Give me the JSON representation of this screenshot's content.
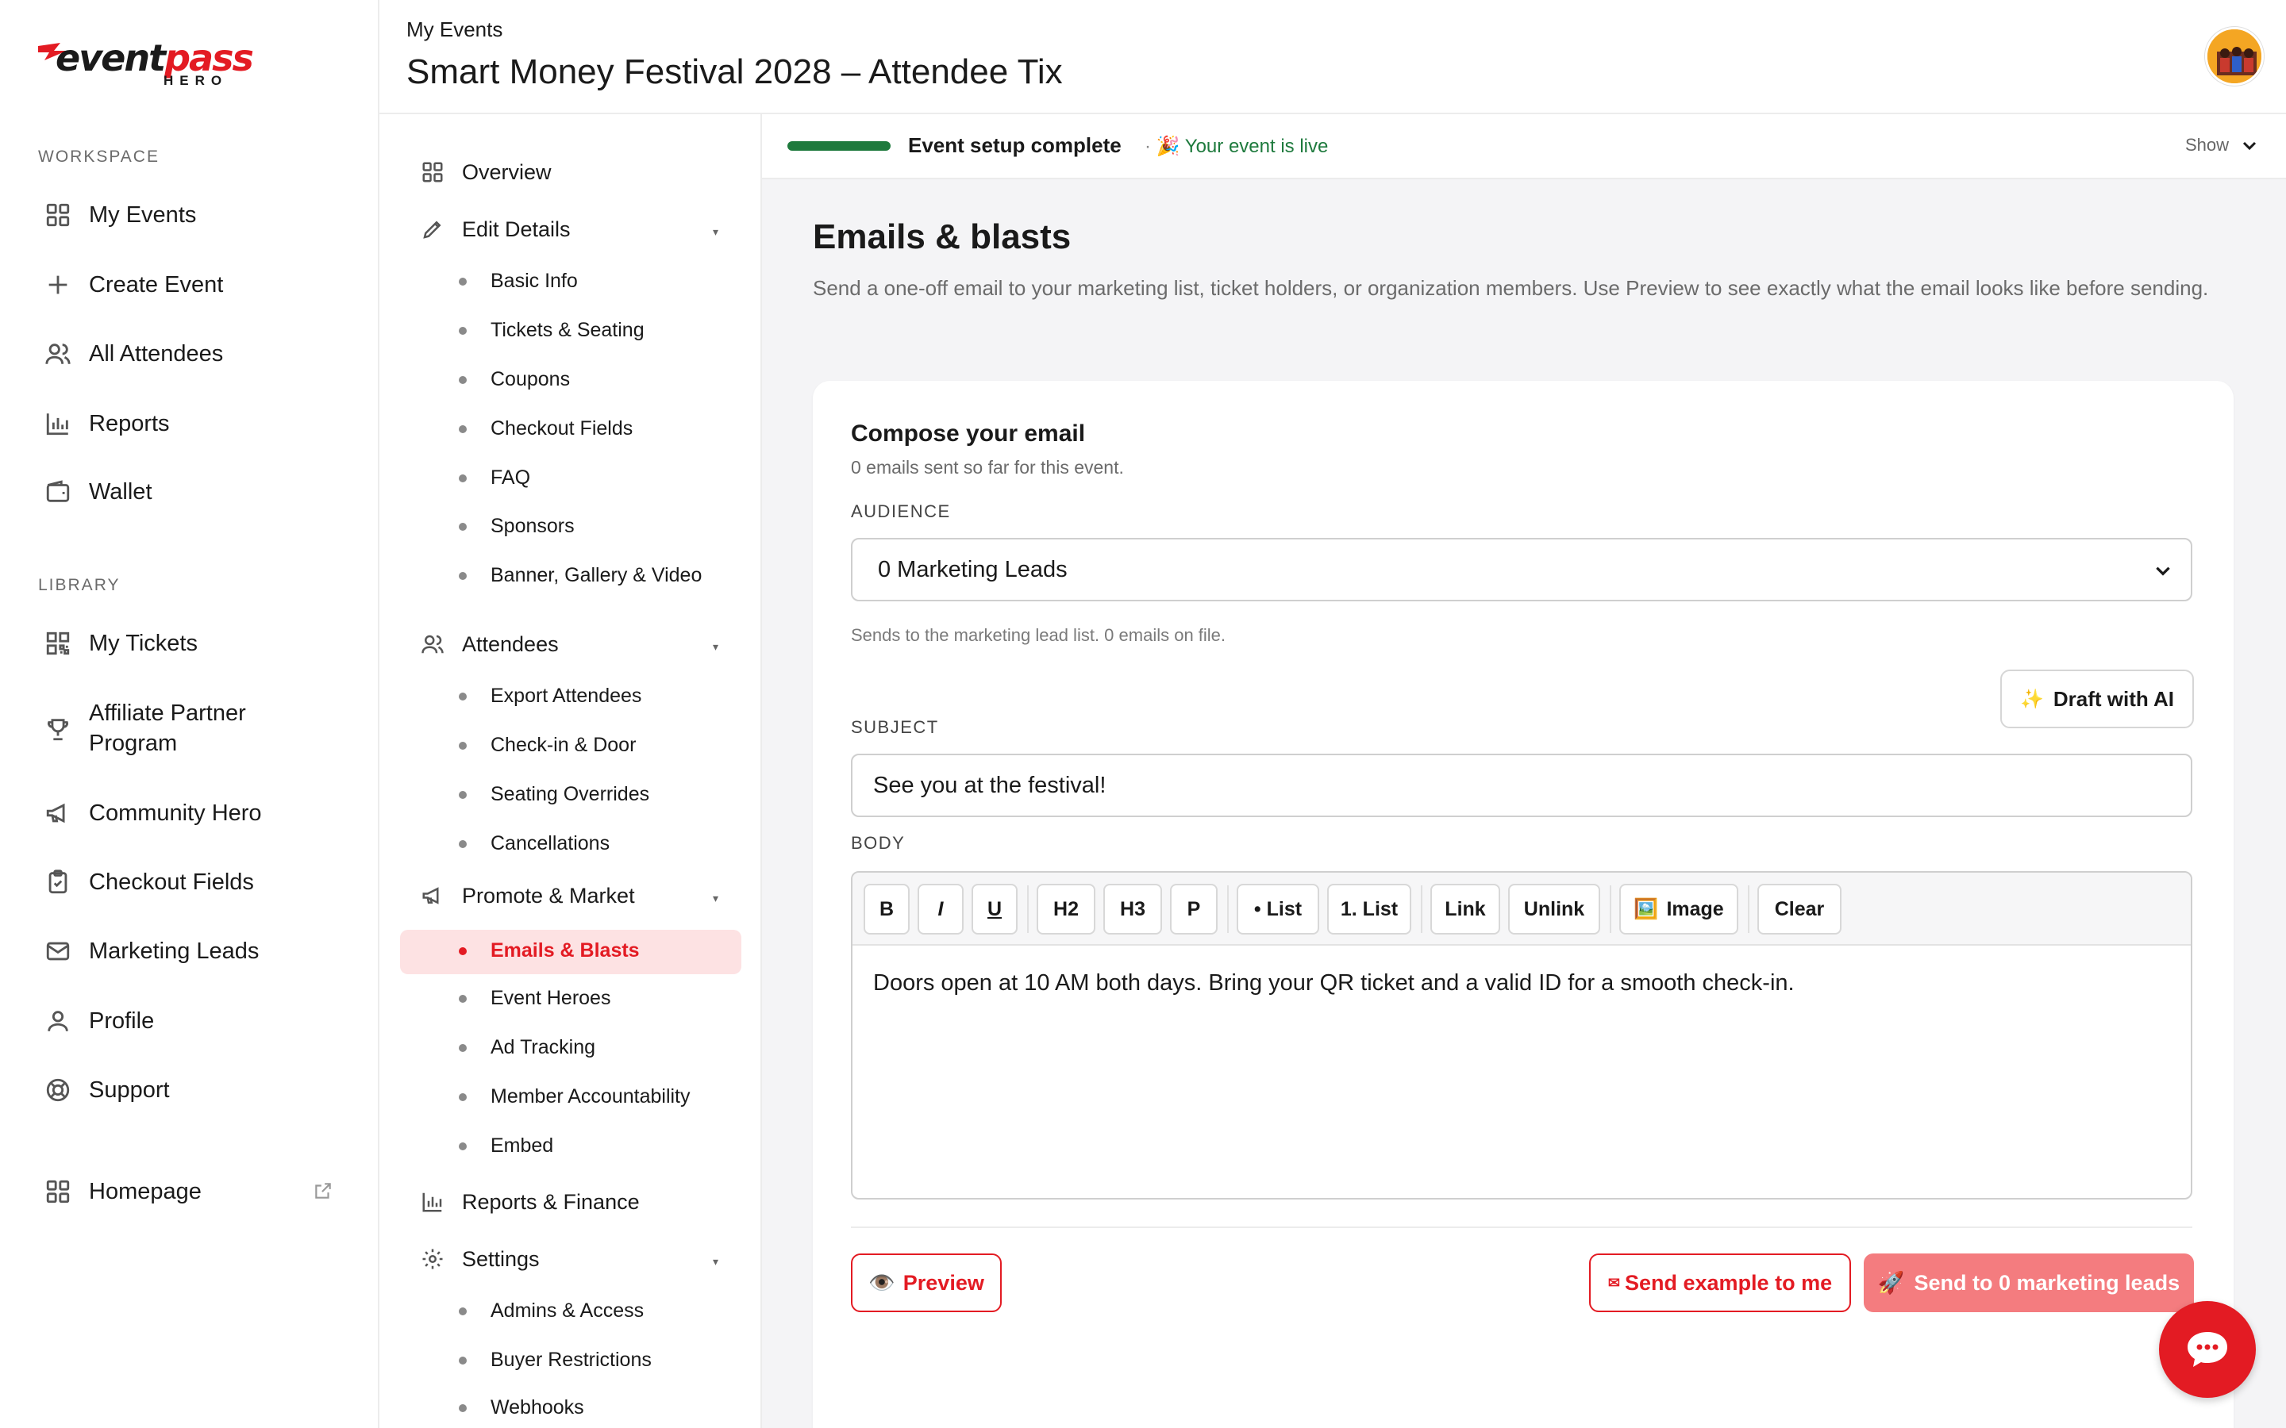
{
  "brand": {
    "logo_word_dark": "event",
    "logo_word_red": "pass",
    "logo_sub": "HERO",
    "accent": "#e31b23",
    "success": "#1e7a3d"
  },
  "sidebar": {
    "workspace_label": "WORKSPACE",
    "library_label": "LIBRARY",
    "workspace": [
      {
        "label": "My Events",
        "icon": "grid-icon"
      },
      {
        "label": "Create Event",
        "icon": "plus-icon"
      },
      {
        "label": "All Attendees",
        "icon": "users-icon"
      },
      {
        "label": "Reports",
        "icon": "bar-chart-icon"
      },
      {
        "label": "Wallet",
        "icon": "wallet-icon"
      }
    ],
    "library": [
      {
        "label": "My Tickets",
        "icon": "qr-code-icon"
      },
      {
        "label": "Affiliate Partner Program",
        "icon": "trophy-icon"
      },
      {
        "label": "Community Hero",
        "icon": "megaphone-icon"
      },
      {
        "label": "Checkout Fields",
        "icon": "clipboard-icon"
      },
      {
        "label": "Marketing Leads",
        "icon": "mail-icon"
      },
      {
        "label": "Profile",
        "icon": "user-icon"
      },
      {
        "label": "Support",
        "icon": "lifebuoy-icon"
      }
    ],
    "homepage": {
      "label": "Homepage",
      "icon": "grid-icon"
    }
  },
  "header": {
    "breadcrumb": "My Events",
    "title": "Smart Money Festival 2028 – Attendee Tix"
  },
  "subnav": {
    "overview": "Overview",
    "edit_details": "Edit Details",
    "edit_items": [
      "Basic Info",
      "Tickets & Seating",
      "Coupons",
      "Checkout Fields",
      "FAQ",
      "Sponsors",
      "Banner, Gallery & Video"
    ],
    "attendees": "Attendees",
    "attendee_items": [
      "Export Attendees",
      "Check-in & Door",
      "Seating Overrides",
      "Cancellations"
    ],
    "promote": "Promote & Market",
    "promote_items": [
      "Emails & Blasts",
      "Event Heroes",
      "Ad Tracking",
      "Member Accountability",
      "Embed"
    ],
    "reports": "Reports & Finance",
    "settings": "Settings",
    "settings_items": [
      "Admins & Access",
      "Buyer Restrictions",
      "Webhooks"
    ]
  },
  "status": {
    "setup": "Event setup complete",
    "live_prefix": "· 🎉",
    "live": "Your event is live",
    "progress": 1.0,
    "toggle": "Show"
  },
  "section": {
    "title": "Emails & blasts",
    "description": "Send a one-off email to your marketing list, ticket holders, or organization members. Use Preview to see exactly what the email looks like before sending."
  },
  "compose": {
    "title": "Compose your email",
    "subtitle": "0 emails sent so far for this event.",
    "audience_label": "AUDIENCE",
    "audience_value": "0 Marketing Leads",
    "audience_help": "Sends to the marketing lead list. 0 emails on file.",
    "ai_button": "Draft with AI",
    "subject_label": "SUBJECT",
    "subject_value": "See you at the festival!",
    "body_label": "BODY",
    "toolbar": [
      "B",
      "I",
      "U",
      "H2",
      "H3",
      "P",
      "• List",
      "1. List",
      "Link",
      "Unlink",
      "Image",
      "Clear"
    ],
    "body_text": "Doors open at 10 AM both days. Bring your QR ticket and a valid ID for a smooth check-in.",
    "preview_button": "Preview",
    "send_example_button": "Send example to me",
    "send_button": "Send to 0 marketing leads"
  }
}
